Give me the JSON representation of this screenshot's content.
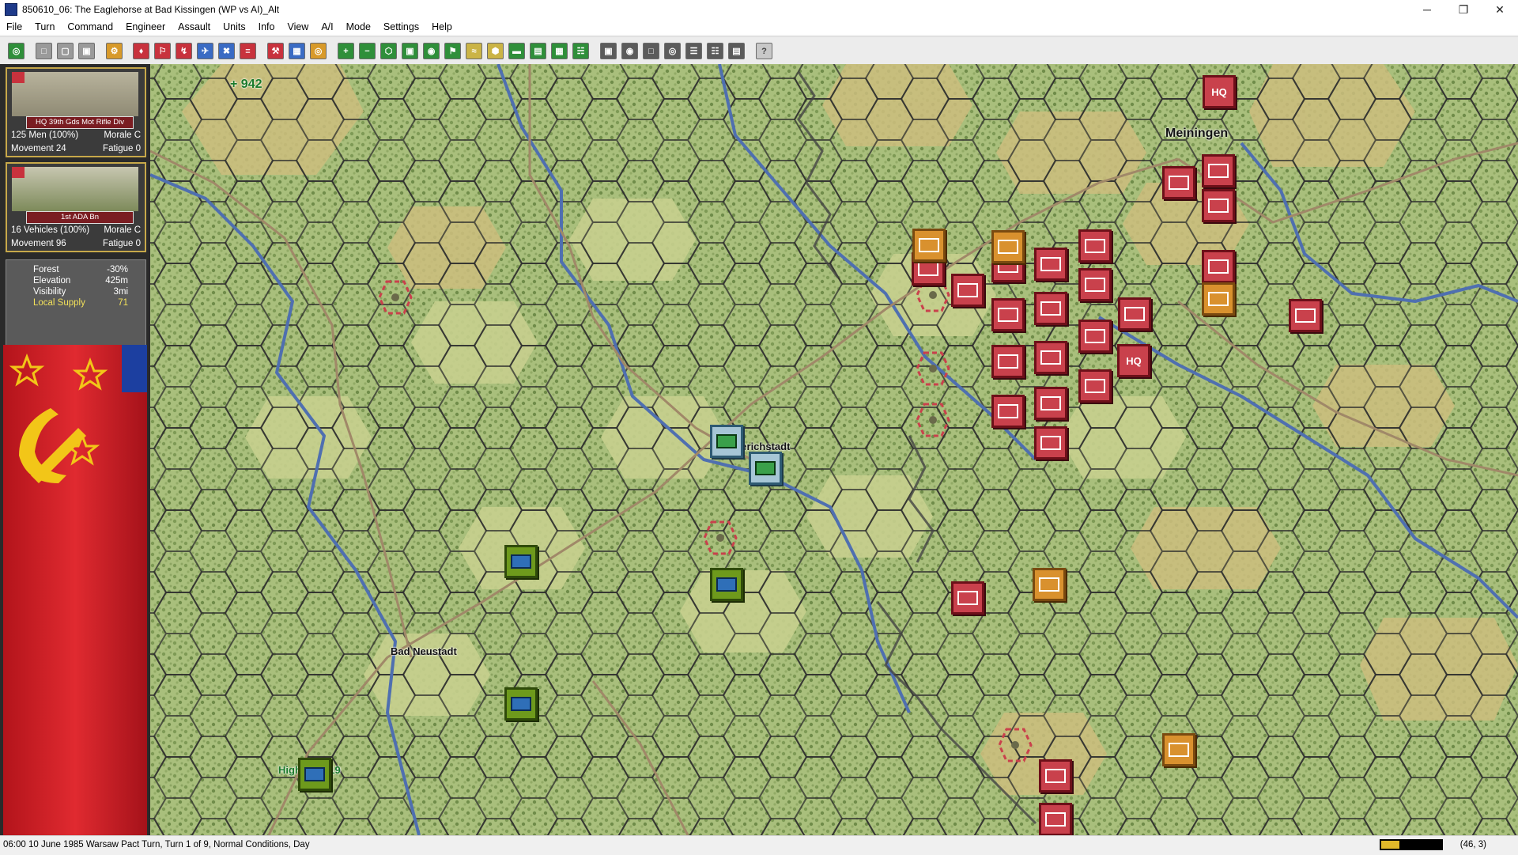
{
  "window": {
    "title": "850610_06: The Eaglehorse at Bad Kissingen (WP vs AI)_Alt",
    "minimize": "─",
    "restore": "❐",
    "close": "✕"
  },
  "menu": [
    "File",
    "Turn",
    "Command",
    "Engineer",
    "Assault",
    "Units",
    "Info",
    "View",
    "A/I",
    "Mode",
    "Settings",
    "Help"
  ],
  "units": [
    {
      "name": "HQ 39th Gds Mot Rifle Div",
      "strength": "125 Men (100%)",
      "morale": "Morale C",
      "movement": "Movement 24",
      "fatigue": "Fatigue 0"
    },
    {
      "name": "1st ADA Bn",
      "strength": "16 Vehicles (100%)",
      "morale": "Morale C",
      "movement": "Movement 96",
      "fatigue": "Fatigue 0"
    }
  ],
  "terrain": {
    "forest_label": "Forest",
    "forest_value": "-30%",
    "elevation_label": "Elevation",
    "elevation_value": "425m",
    "visibility_label": "Visibility",
    "visibility_value": "3mi",
    "supply_label": "Local Supply",
    "supply_value": "71"
  },
  "map": {
    "score": "+ 942",
    "cities": {
      "meiningen": "Meiningen",
      "mellrichstadt": "Mellerichstadt",
      "bad_neustadt": "Bad Neustadt",
      "highway": "Highway #19"
    },
    "hq_label": "HQ"
  },
  "status": {
    "text": "06:00 10 June 1985 Warsaw Pact Turn, Turn 1 of 9, Normal Conditions, Day",
    "coord": "(46, 3)",
    "meter_level": 0.3
  },
  "colors": {
    "pact_red": "#c9414c",
    "nato_green": "#6e9a1c",
    "orange": "#d9912e",
    "map_green": "#b5c98a",
    "map_tan": "#cdbd7e"
  }
}
